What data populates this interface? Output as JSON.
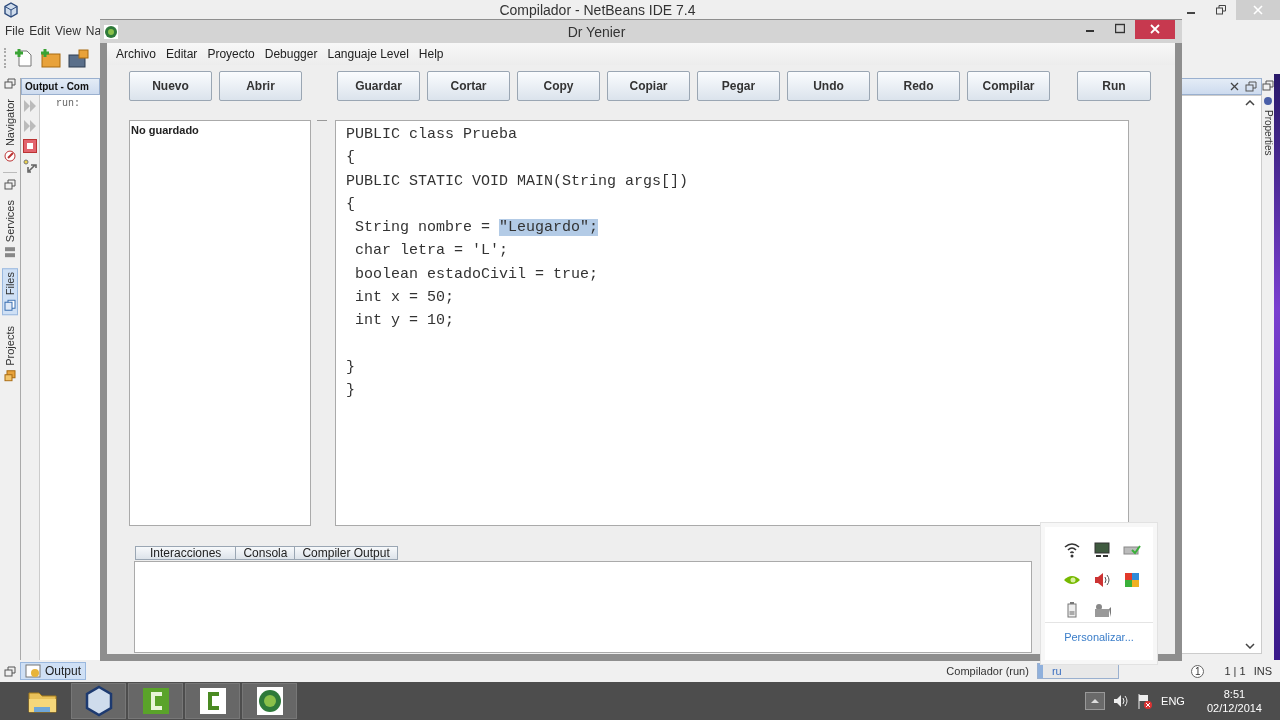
{
  "ide": {
    "title": "Compilador - NetBeans IDE 7.4",
    "menu": [
      "File",
      "Edit",
      "View",
      "Na"
    ],
    "side_tabs": [
      {
        "label": "Navigator",
        "selected": false
      },
      {
        "label": "Services",
        "selected": false
      },
      {
        "label": "Files",
        "selected": true
      },
      {
        "label": "Projects",
        "selected": false
      }
    ],
    "output_panel": {
      "title": "Output - Com",
      "text": "run:"
    },
    "right_tab": "Properties",
    "bottom_tab": {
      "label": "Output",
      "selected": true
    },
    "status_bar": {
      "task": "Compilador (run)",
      "progress_text": "ru",
      "level": 0.06,
      "notifications": "1",
      "position": "1 | 1",
      "mode": "INS"
    }
  },
  "dialog": {
    "title": "Dr Yenier",
    "menu": [
      "Archivo",
      "Editar",
      "Proyecto",
      "Debugger",
      "Languaje Level",
      "Help"
    ],
    "buttons": [
      "Nuevo",
      "Abrir",
      "Guardar",
      "Cortar",
      "Copy",
      "Copiar",
      "Pegar",
      "Undo",
      "Redo",
      "Compilar",
      "Run"
    ],
    "file_status": "No guardado",
    "code": [
      {
        "segments": [
          {
            "text": "PUBLIC class Prueba",
            "selected": false
          }
        ]
      },
      {
        "segments": [
          {
            "text": "{",
            "selected": false
          }
        ]
      },
      {
        "segments": [
          {
            "text": "PUBLIC STATIC VOID MAIN(String args[])",
            "selected": false
          }
        ]
      },
      {
        "segments": [
          {
            "text": "{",
            "selected": false
          }
        ]
      },
      {
        "segments": [
          {
            "text": " String nombre = ",
            "selected": false
          },
          {
            "text": "\"Leugardo\";",
            "selected": true
          }
        ]
      },
      {
        "segments": [
          {
            "text": " char letra = 'L';",
            "selected": false
          }
        ]
      },
      {
        "segments": [
          {
            "text": " boolean estadoCivil = true;",
            "selected": false
          }
        ]
      },
      {
        "segments": [
          {
            "text": " int x = 50;",
            "selected": false
          }
        ]
      },
      {
        "segments": [
          {
            "text": " int y = 10;",
            "selected": false
          }
        ]
      },
      {
        "kind": "blank"
      },
      {
        "segments": [
          {
            "text": "}",
            "selected": false
          }
        ]
      },
      {
        "segments": [
          {
            "text": "}",
            "selected": false
          }
        ]
      }
    ],
    "bottom_tabs": [
      "Interacciones",
      "Consola",
      "Compiler Output"
    ]
  },
  "tray_popup": {
    "link": "Personalizar..."
  },
  "taskbar": {
    "language": "ENG",
    "time": "8:51",
    "date": "02/12/2014"
  }
}
